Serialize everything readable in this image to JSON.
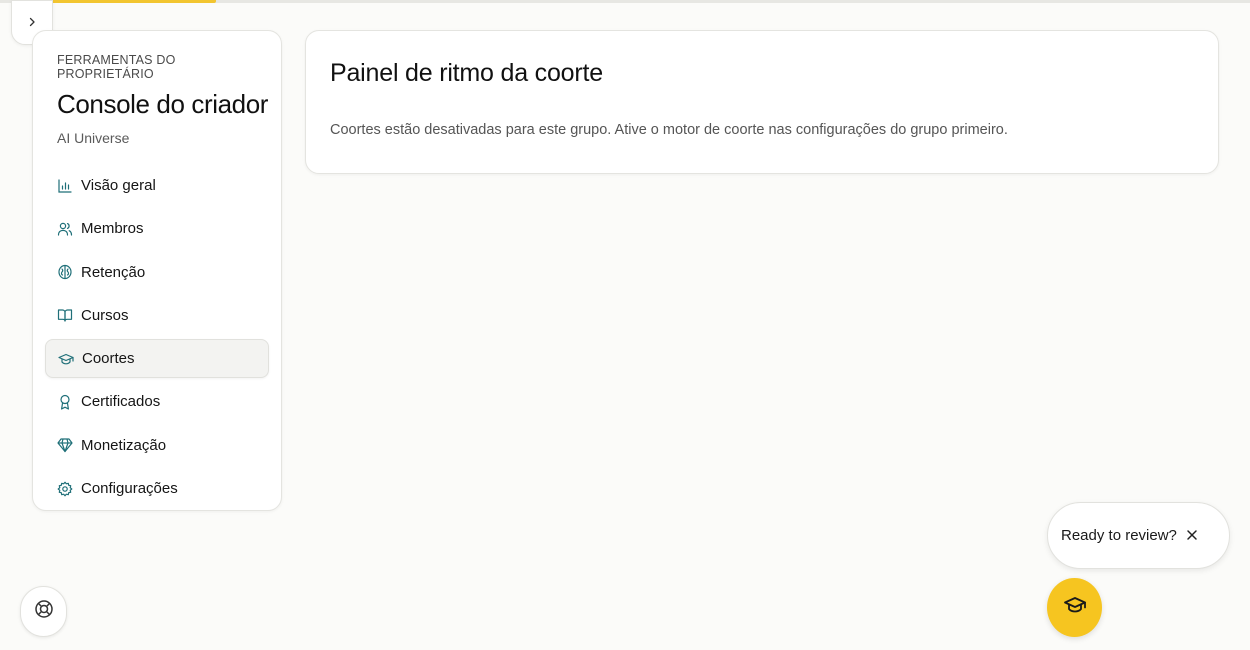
{
  "progress": {
    "fraction": 0.16,
    "color": "#f2c530"
  },
  "sidebar": {
    "eyebrow": "FERRAMENTAS DO PROPRIETÁRIO",
    "title": "Console do criador",
    "org": "AI Universe",
    "items": [
      {
        "label": "Visão geral",
        "icon": "bar-chart-icon",
        "active": false
      },
      {
        "label": "Membros",
        "icon": "users-icon",
        "active": false
      },
      {
        "label": "Retenção",
        "icon": "brain-icon",
        "active": false
      },
      {
        "label": "Cursos",
        "icon": "book-open-icon",
        "active": false
      },
      {
        "label": "Coortes",
        "icon": "graduation-cap-icon",
        "active": true
      },
      {
        "label": "Certificados",
        "icon": "award-icon",
        "active": false
      },
      {
        "label": "Monetização",
        "icon": "gem-icon",
        "active": false
      },
      {
        "label": "Configurações",
        "icon": "gear-icon",
        "active": false
      }
    ]
  },
  "panel": {
    "title": "Painel de ritmo da coorte",
    "message": "Coortes estão desativadas para este grupo. Ative o motor de coorte nas configurações do grupo primeiro."
  },
  "review": {
    "label": "Ready to review?"
  },
  "colors": {
    "accent": "#f6c520",
    "icon_teal": "#1f6f78"
  }
}
